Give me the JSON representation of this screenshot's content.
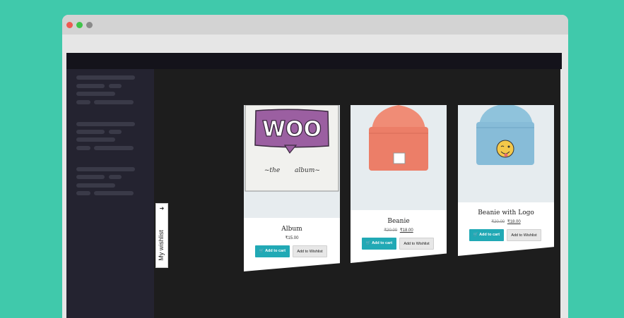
{
  "wishlist": {
    "label": "My wishlist",
    "arrow": "➜"
  },
  "products": [
    {
      "name": "Album",
      "price_new": "₹15.00",
      "cart_label": "Add to cart",
      "wishlist_label": "Add to Wishlist",
      "image_text": {
        "logo": "WOO",
        "caption_left": "~the",
        "caption_right": "album~"
      }
    },
    {
      "name": "Beanie",
      "price_old": "₹20.00",
      "price_new": "₹18.00",
      "cart_label": "Add to cart",
      "wishlist_label": "Add to Wishlist"
    },
    {
      "name": "Beanie with Logo",
      "price_old": "₹20.00",
      "price_new": "₹18.00",
      "cart_label": "Add to cart",
      "wishlist_label": "Add to Wishlist"
    }
  ],
  "cart_icon": "cart-icon",
  "colors": {
    "background": "#40c9ab",
    "accent": "#21a9b5",
    "sidebar": "#242330",
    "content": "#1d1d1d"
  }
}
